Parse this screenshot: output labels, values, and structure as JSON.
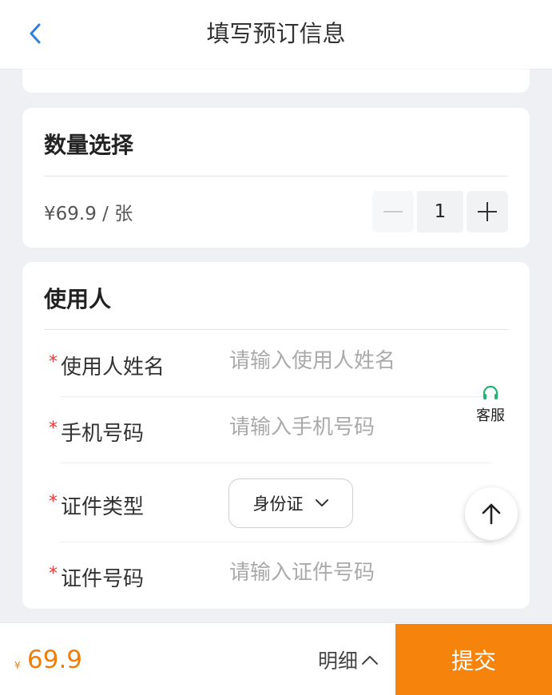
{
  "header": {
    "title": "填写预订信息"
  },
  "quantity": {
    "title": "数量选择",
    "price_unit": "¥69.9 / 张",
    "value": "1"
  },
  "user": {
    "title": "使用人",
    "required_mark": "*",
    "fields": [
      {
        "label": "使用人姓名",
        "placeholder": "请输入使用人姓名"
      },
      {
        "label": "手机号码",
        "placeholder": "请输入手机号码"
      },
      {
        "label": "证件类型",
        "value": "身份证"
      },
      {
        "label": "证件号码",
        "placeholder": "请输入证件号码"
      }
    ]
  },
  "floating": {
    "service_label": "客服"
  },
  "footer": {
    "currency": "¥",
    "total": "69.9",
    "detail_label": "明细",
    "submit_label": "提交"
  },
  "colors": {
    "accent": "#f5830c",
    "price": "#f07f0a",
    "required": "#e23b3b",
    "back": "#2f7fe0",
    "service_icon": "#1fb574"
  },
  "icons": {
    "back": "chevron-left-icon",
    "select": "chevron-down-icon",
    "detail": "chevron-up-icon",
    "minus": "minus-icon",
    "plus": "plus-icon",
    "service": "headset-icon",
    "top": "arrow-up-icon"
  }
}
